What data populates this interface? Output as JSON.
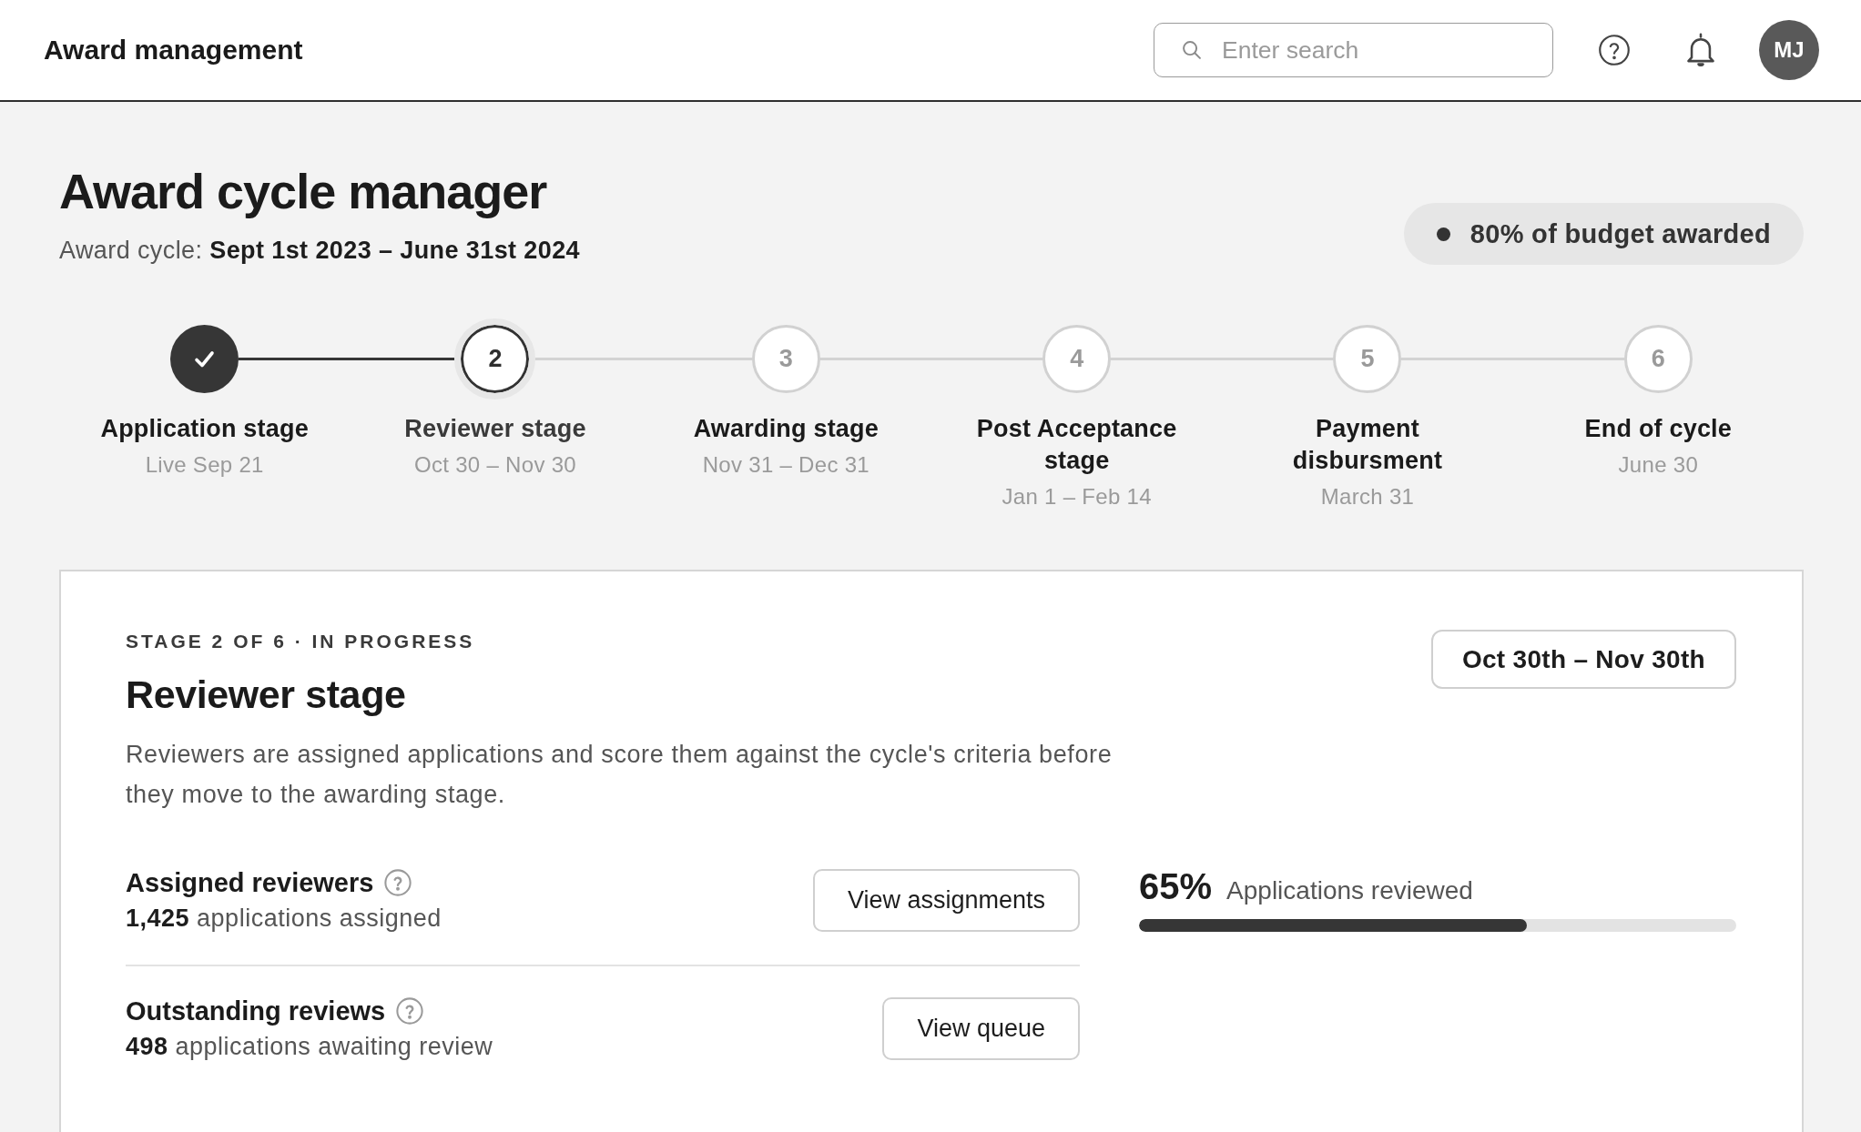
{
  "header": {
    "title": "Award management",
    "search": {
      "placeholder": "Enter search"
    },
    "avatar": {
      "initials": "MJ"
    }
  },
  "page": {
    "title": "Award cycle manager",
    "subtitle": "Award cycle: **Sept 1st 2023 – June 31st 2024**",
    "budget_badge": "80% of budget awarded"
  },
  "steps": [
    {
      "label": "Application stage",
      "date": "Live Sep 21",
      "completed": true,
      "selected": false
    },
    {
      "number": "2",
      "label": "Reviewer stage",
      "date": "Oct 30 – Nov 30",
      "completed": false,
      "selected": true
    },
    {
      "number": "3",
      "label": "Awarding stage",
      "date": "Nov 31 – Dec 31",
      "completed": false,
      "selected": false
    },
    {
      "number": "4",
      "label": "Post Acceptance stage",
      "date": "Jan 1 – Feb 14",
      "completed": false,
      "selected": false
    },
    {
      "number": "5",
      "label": "Payment disbursment",
      "date": "March 31",
      "completed": false,
      "selected": false
    },
    {
      "number": "6",
      "label": "End of cycle",
      "date": "June 30",
      "completed": false,
      "selected": false
    }
  ],
  "stage_card": {
    "overline": "STAGE 2 OF 6 · IN PROGRESS",
    "title": "Reviewer stage",
    "date_range": "Oct 30th – Nov 30th",
    "description": "Reviewers are assigned applications and score them against the cycle's criteria before they move to the awarding stage.",
    "metrics": [
      {
        "title": "Assigned reviewers",
        "detail": "**1,425** applications assigned",
        "action": "View assignments"
      },
      {
        "title": "Outstanding reviews",
        "detail": "**498** applications awaiting review",
        "action": "View queue"
      }
    ],
    "progress": {
      "value": "65%",
      "label": "Applications reviewed",
      "level": 0.65
    }
  }
}
